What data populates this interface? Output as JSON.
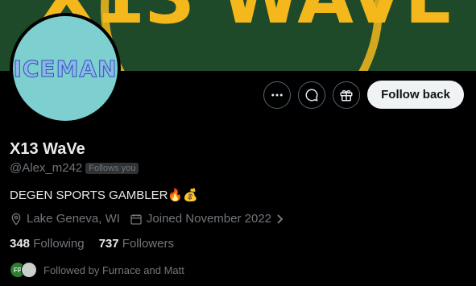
{
  "banner": {
    "text": "X13 WAVE",
    "bg_color": "#1f4a2a",
    "text_color": "#f5b81c"
  },
  "avatar": {
    "text": "ICEMAN",
    "bg_color": "#7dcfd0"
  },
  "actions": {
    "more_icon": "more-horizontal-icon",
    "message_icon": "message-icon",
    "subscribe_icon": "gift-icon",
    "follow_back_label": "Follow back"
  },
  "profile": {
    "name": "X13 WaVe",
    "handle": "@Alex_m242",
    "follows_you": "Follows you",
    "bio": "DEGEN SPORTS GAMBLER🔥💰",
    "location": "Lake Geneva, WI",
    "joined": "Joined November 2022"
  },
  "stats": {
    "following_count": "348",
    "following_label": "Following",
    "followers_count": "737",
    "followers_label": "Followers"
  },
  "followed_by": {
    "text": "Followed by Furnace and Matt",
    "avatar_initials": "FP"
  }
}
